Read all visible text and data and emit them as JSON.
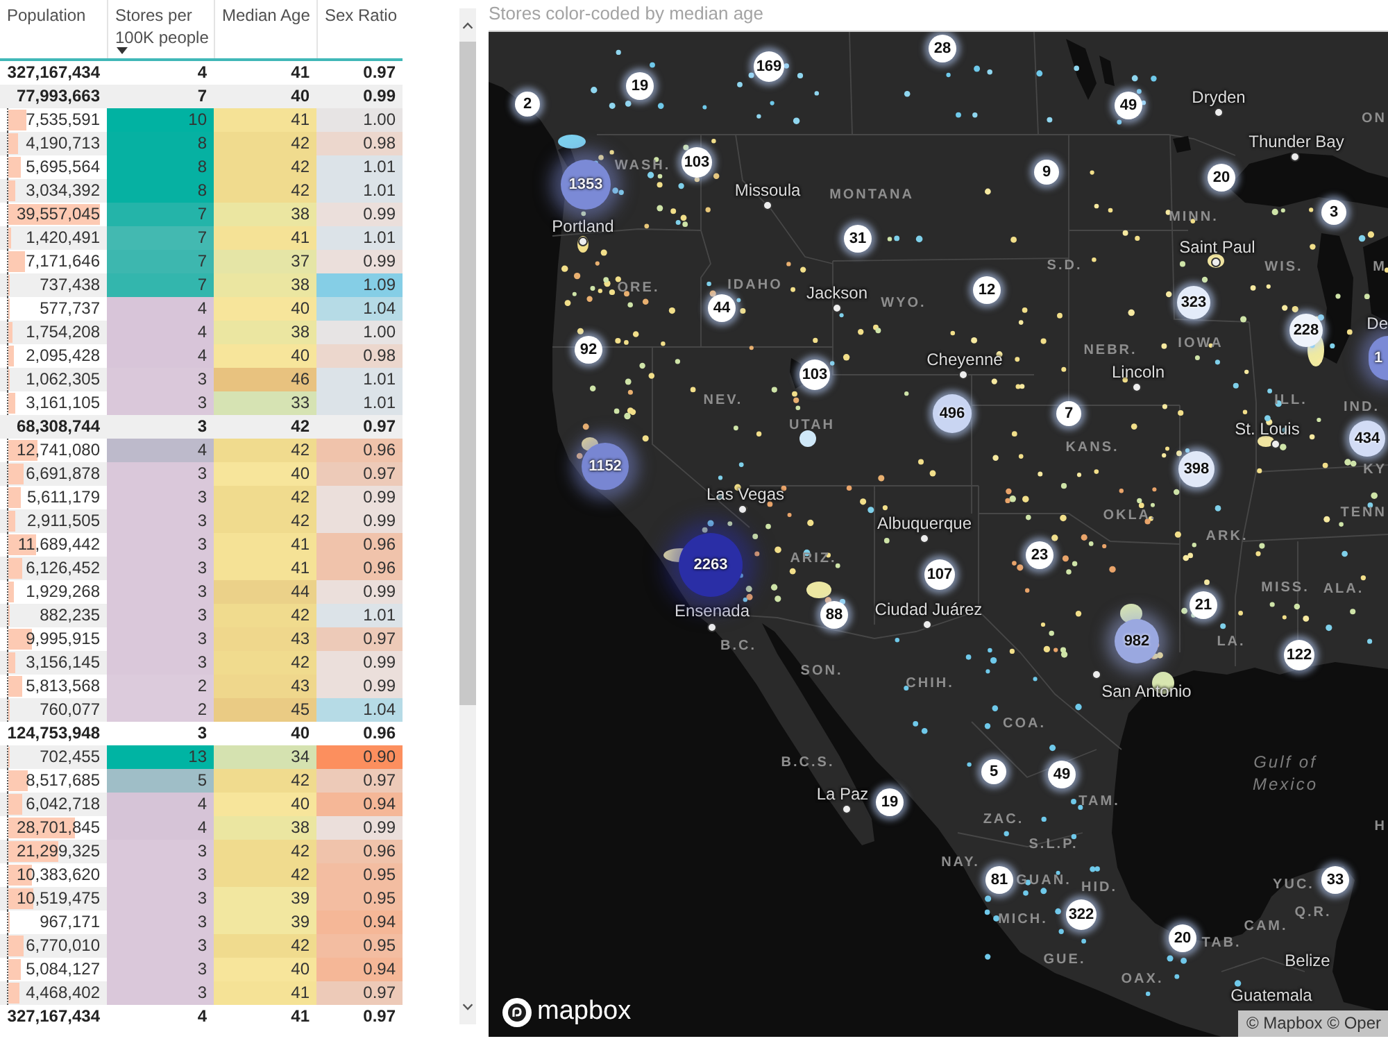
{
  "table": {
    "columns": [
      {
        "label": "Population",
        "sorted": false
      },
      {
        "label": "Stores per 100K people",
        "sorted": true
      },
      {
        "label": "Median Age",
        "sorted": false
      },
      {
        "label": "Sex Ratio",
        "sorted": false
      }
    ],
    "rows": [
      {
        "kind": "total",
        "cells": [
          {
            "text": "327,167,434"
          },
          {
            "text": "4"
          },
          {
            "text": "41"
          },
          {
            "text": "0.97"
          }
        ]
      },
      {
        "kind": "total",
        "cells": [
          {
            "text": "77,993,663"
          },
          {
            "text": "7"
          },
          {
            "text": "40"
          },
          {
            "text": "0.99"
          }
        ]
      },
      {
        "kind": "item",
        "cells": [
          {
            "text": "7,535,591",
            "level": 0.18
          },
          {
            "text": "10",
            "color": "#01b2a2"
          },
          {
            "text": "41",
            "color": "#f5e296"
          },
          {
            "text": "1.00",
            "color": "#e7e4e4"
          }
        ]
      },
      {
        "kind": "item",
        "cells": [
          {
            "text": "4,190,713",
            "level": 0.1
          },
          {
            "text": "8",
            "color": "#06b1a2"
          },
          {
            "text": "42",
            "color": "#f0db8e"
          },
          {
            "text": "0.98",
            "color": "#ecd7cd"
          }
        ]
      },
      {
        "kind": "item",
        "cells": [
          {
            "text": "5,695,564",
            "level": 0.13
          },
          {
            "text": "8",
            "color": "#06b1a2"
          },
          {
            "text": "42",
            "color": "#f0db8e"
          },
          {
            "text": "1.01",
            "color": "#dce3e8"
          }
        ]
      },
      {
        "kind": "item",
        "cells": [
          {
            "text": "3,034,392",
            "level": 0.07
          },
          {
            "text": "8",
            "color": "#06b1a2"
          },
          {
            "text": "42",
            "color": "#f0db8e"
          },
          {
            "text": "1.01",
            "color": "#dce3e8"
          }
        ]
      },
      {
        "kind": "item",
        "cells": [
          {
            "text": "39,557,045",
            "level": 0.93
          },
          {
            "text": "7",
            "color": "#24b4a9"
          },
          {
            "text": "38",
            "color": "#ebe6a1"
          },
          {
            "text": "0.99",
            "color": "#ebdfdb"
          }
        ]
      },
      {
        "kind": "item",
        "cells": [
          {
            "text": "1,420,491",
            "level": 0.03
          },
          {
            "text": "7",
            "color": "#43b9b1"
          },
          {
            "text": "41",
            "color": "#f5e296"
          },
          {
            "text": "1.01",
            "color": "#dce3e8"
          }
        ]
      },
      {
        "kind": "item",
        "cells": [
          {
            "text": "7,171,646",
            "level": 0.17
          },
          {
            "text": "7",
            "color": "#3db7af"
          },
          {
            "text": "37",
            "color": "#e5e5a6"
          },
          {
            "text": "0.99",
            "color": "#ebdfdb"
          }
        ]
      },
      {
        "kind": "item",
        "cells": [
          {
            "text": "737,438",
            "level": 0.02
          },
          {
            "text": "7",
            "color": "#33b6ad"
          },
          {
            "text": "38",
            "color": "#ebe6a1"
          },
          {
            "text": "1.09",
            "color": "#85cee6"
          }
        ]
      },
      {
        "kind": "item",
        "cells": [
          {
            "text": "577,737",
            "level": 0.01
          },
          {
            "text": "4",
            "color": "#d8c5d9"
          },
          {
            "text": "40",
            "color": "#f7e59b"
          },
          {
            "text": "1.04",
            "color": "#b6dbe6"
          }
        ]
      },
      {
        "kind": "item",
        "cells": [
          {
            "text": "1,754,208",
            "level": 0.04
          },
          {
            "text": "4",
            "color": "#d8c5d9"
          },
          {
            "text": "38",
            "color": "#ebe6a1"
          },
          {
            "text": "1.00",
            "color": "#e7e4e4"
          }
        ]
      },
      {
        "kind": "item",
        "cells": [
          {
            "text": "2,095,428",
            "level": 0.05
          },
          {
            "text": "4",
            "color": "#d8c5d9"
          },
          {
            "text": "40",
            "color": "#f7e59b"
          },
          {
            "text": "0.98",
            "color": "#ecd7cd"
          }
        ]
      },
      {
        "kind": "item",
        "cells": [
          {
            "text": "1,062,305",
            "level": 0.02
          },
          {
            "text": "3",
            "color": "#dac8da"
          },
          {
            "text": "46",
            "color": "#e8c27f"
          },
          {
            "text": "1.01",
            "color": "#dce3e8"
          }
        ]
      },
      {
        "kind": "item",
        "cells": [
          {
            "text": "3,161,105",
            "level": 0.07
          },
          {
            "text": "3",
            "color": "#dac8da"
          },
          {
            "text": "33",
            "color": "#d6e3b3"
          },
          {
            "text": "1.01",
            "color": "#dce3e8"
          }
        ]
      },
      {
        "kind": "total",
        "cells": [
          {
            "text": "68,308,744"
          },
          {
            "text": "3"
          },
          {
            "text": "42"
          },
          {
            "text": "0.97"
          }
        ]
      },
      {
        "kind": "item",
        "cells": [
          {
            "text": "12,741,080",
            "level": 0.3
          },
          {
            "text": "4",
            "color": "#bdbacb"
          },
          {
            "text": "42",
            "color": "#f0db8e"
          },
          {
            "text": "0.96",
            "color": "#f0c3ab"
          }
        ]
      },
      {
        "kind": "item",
        "cells": [
          {
            "text": "6,691,878",
            "level": 0.16
          },
          {
            "text": "3",
            "color": "#dac8da"
          },
          {
            "text": "40",
            "color": "#f7e59b"
          },
          {
            "text": "0.97",
            "color": "#edcab8"
          }
        ]
      },
      {
        "kind": "item",
        "cells": [
          {
            "text": "5,611,179",
            "level": 0.13
          },
          {
            "text": "3",
            "color": "#dac8da"
          },
          {
            "text": "42",
            "color": "#f0db8e"
          },
          {
            "text": "0.99",
            "color": "#ebdfdb"
          }
        ]
      },
      {
        "kind": "item",
        "cells": [
          {
            "text": "2,911,505",
            "level": 0.07
          },
          {
            "text": "3",
            "color": "#dac8da"
          },
          {
            "text": "42",
            "color": "#f0db8e"
          },
          {
            "text": "0.99",
            "color": "#ebdfdb"
          }
        ]
      },
      {
        "kind": "item",
        "cells": [
          {
            "text": "11,689,442",
            "level": 0.28
          },
          {
            "text": "3",
            "color": "#dac8da"
          },
          {
            "text": "41",
            "color": "#f5e296"
          },
          {
            "text": "0.96",
            "color": "#f0c3ab"
          }
        ]
      },
      {
        "kind": "item",
        "cells": [
          {
            "text": "6,126,452",
            "level": 0.14
          },
          {
            "text": "3",
            "color": "#dac8da"
          },
          {
            "text": "41",
            "color": "#f5e296"
          },
          {
            "text": "0.96",
            "color": "#f0c3ab"
          }
        ]
      },
      {
        "kind": "item",
        "cells": [
          {
            "text": "1,929,268",
            "level": 0.05
          },
          {
            "text": "3",
            "color": "#dac8da"
          },
          {
            "text": "44",
            "color": "#ebd189"
          },
          {
            "text": "0.99",
            "color": "#ebdfdb"
          }
        ]
      },
      {
        "kind": "item",
        "cells": [
          {
            "text": "882,235",
            "level": 0.02
          },
          {
            "text": "3",
            "color": "#dac8da"
          },
          {
            "text": "42",
            "color": "#f0db8e"
          },
          {
            "text": "1.01",
            "color": "#dce3e8"
          }
        ]
      },
      {
        "kind": "item",
        "cells": [
          {
            "text": "9,995,915",
            "level": 0.24
          },
          {
            "text": "3",
            "color": "#dac8da"
          },
          {
            "text": "43",
            "color": "#efd78c"
          },
          {
            "text": "0.97",
            "color": "#edcab8"
          }
        ]
      },
      {
        "kind": "item",
        "cells": [
          {
            "text": "3,156,145",
            "level": 0.07
          },
          {
            "text": "3",
            "color": "#dac8da"
          },
          {
            "text": "42",
            "color": "#f0db8e"
          },
          {
            "text": "0.99",
            "color": "#ebdfdb"
          }
        ]
      },
      {
        "kind": "item",
        "cells": [
          {
            "text": "5,813,568",
            "level": 0.14
          },
          {
            "text": "2",
            "color": "#dccbdc"
          },
          {
            "text": "43",
            "color": "#efd78c"
          },
          {
            "text": "0.99",
            "color": "#ebdfdb"
          }
        ]
      },
      {
        "kind": "item",
        "cells": [
          {
            "text": "760,077",
            "level": 0.02
          },
          {
            "text": "2",
            "color": "#dccbdc"
          },
          {
            "text": "45",
            "color": "#eacb84"
          },
          {
            "text": "1.04",
            "color": "#b6dbe6"
          }
        ]
      },
      {
        "kind": "total",
        "cells": [
          {
            "text": "124,753,948"
          },
          {
            "text": "3"
          },
          {
            "text": "40"
          },
          {
            "text": "0.96"
          }
        ]
      },
      {
        "kind": "item",
        "cells": [
          {
            "text": "702,455",
            "level": 0.02
          },
          {
            "text": "13",
            "color": "#00b4a3"
          },
          {
            "text": "34",
            "color": "#d5e2b0"
          },
          {
            "text": "0.90",
            "color": "#fc8f5e"
          }
        ]
      },
      {
        "kind": "item",
        "cells": [
          {
            "text": "8,517,685",
            "level": 0.2
          },
          {
            "text": "5",
            "color": "#9fbec7"
          },
          {
            "text": "42",
            "color": "#f0db8e"
          },
          {
            "text": "0.97",
            "color": "#edcab8"
          }
        ]
      },
      {
        "kind": "item",
        "cells": [
          {
            "text": "6,042,718",
            "level": 0.14
          },
          {
            "text": "4",
            "color": "#d6c4d7"
          },
          {
            "text": "40",
            "color": "#f7e59b"
          },
          {
            "text": "0.94",
            "color": "#f5b797"
          }
        ]
      },
      {
        "kind": "item",
        "cells": [
          {
            "text": "28,701,845",
            "level": 0.68
          },
          {
            "text": "4",
            "color": "#d6c4d7"
          },
          {
            "text": "38",
            "color": "#ebe6a1"
          },
          {
            "text": "0.99",
            "color": "#ebdfdb"
          }
        ]
      },
      {
        "kind": "item",
        "cells": [
          {
            "text": "21,299,325",
            "level": 0.5
          },
          {
            "text": "3",
            "color": "#dac8da"
          },
          {
            "text": "42",
            "color": "#f0db8e"
          },
          {
            "text": "0.96",
            "color": "#f0c3ab"
          }
        ]
      },
      {
        "kind": "item",
        "cells": [
          {
            "text": "10,383,620",
            "level": 0.24
          },
          {
            "text": "3",
            "color": "#dac8da"
          },
          {
            "text": "42",
            "color": "#f0db8e"
          },
          {
            "text": "0.95",
            "color": "#f3bda1"
          }
        ]
      },
      {
        "kind": "item",
        "cells": [
          {
            "text": "10,519,475",
            "level": 0.25
          },
          {
            "text": "3",
            "color": "#dac8da"
          },
          {
            "text": "39",
            "color": "#f2e7a0"
          },
          {
            "text": "0.95",
            "color": "#f3bda1"
          }
        ]
      },
      {
        "kind": "item",
        "cells": [
          {
            "text": "967,171",
            "level": 0.02
          },
          {
            "text": "3",
            "color": "#dac8da"
          },
          {
            "text": "39",
            "color": "#f2e7a0"
          },
          {
            "text": "0.94",
            "color": "#f5b797"
          }
        ]
      },
      {
        "kind": "item",
        "cells": [
          {
            "text": "6,770,010",
            "level": 0.16
          },
          {
            "text": "3",
            "color": "#dac8da"
          },
          {
            "text": "42",
            "color": "#f0db8e"
          },
          {
            "text": "0.95",
            "color": "#f3bda1"
          }
        ]
      },
      {
        "kind": "item",
        "cells": [
          {
            "text": "5,084,127",
            "level": 0.12
          },
          {
            "text": "3",
            "color": "#dac8da"
          },
          {
            "text": "40",
            "color": "#f7e59b"
          },
          {
            "text": "0.94",
            "color": "#f5b797"
          }
        ]
      },
      {
        "kind": "item",
        "cells": [
          {
            "text": "4,468,402",
            "level": 0.11
          },
          {
            "text": "3",
            "color": "#dac8da"
          },
          {
            "text": "41",
            "color": "#f5e296"
          },
          {
            "text": "0.97",
            "color": "#edcab8"
          }
        ]
      }
    ],
    "footer": {
      "cells": [
        {
          "text": "327,167,434"
        },
        {
          "text": "4"
        },
        {
          "text": "41"
        },
        {
          "text": "0.97"
        }
      ]
    }
  },
  "map": {
    "title": "Stores color-coded by median age",
    "places": [
      {
        "text": "Dryden",
        "kind": "city"
      },
      {
        "text": "ON",
        "kind": "region"
      },
      {
        "text": "Thunder Bay",
        "kind": "city"
      },
      {
        "text": "WASH.",
        "kind": "region"
      },
      {
        "text": "Missoula",
        "kind": "city"
      },
      {
        "text": "MONTANA",
        "kind": "region"
      },
      {
        "text": "Portland",
        "kind": "city"
      },
      {
        "text": "MINN.",
        "kind": "region"
      },
      {
        "text": "Saint Paul",
        "kind": "city"
      },
      {
        "text": "S.D.",
        "kind": "region"
      },
      {
        "text": "WIS.",
        "kind": "region"
      },
      {
        "text": "M",
        "kind": "region"
      },
      {
        "text": "ORE.",
        "kind": "region"
      },
      {
        "text": "IDAHO",
        "kind": "region"
      },
      {
        "text": "Jackson",
        "kind": "city"
      },
      {
        "text": "WYO.",
        "kind": "region"
      },
      {
        "text": "De",
        "kind": "city"
      },
      {
        "text": "Cheyenne",
        "kind": "city"
      },
      {
        "text": "NEBR.",
        "kind": "region"
      },
      {
        "text": "IOWA",
        "kind": "region"
      },
      {
        "text": "Lincoln",
        "kind": "city"
      },
      {
        "text": "NEV.",
        "kind": "region"
      },
      {
        "text": "ILL.",
        "kind": "region"
      },
      {
        "text": "IND.",
        "kind": "region"
      },
      {
        "text": "UTAH",
        "kind": "region"
      },
      {
        "text": "St. Louis",
        "kind": "city"
      },
      {
        "text": "KANS.",
        "kind": "region"
      },
      {
        "text": "KY",
        "kind": "region"
      },
      {
        "text": "Las Vegas",
        "kind": "city"
      },
      {
        "text": "Albuquerque",
        "kind": "city"
      },
      {
        "text": "OKLA.",
        "kind": "region"
      },
      {
        "text": "TENN",
        "kind": "region"
      },
      {
        "text": "ARK.",
        "kind": "region"
      },
      {
        "text": "ARIZ.",
        "kind": "region"
      },
      {
        "text": "MISS.",
        "kind": "region"
      },
      {
        "text": "ALA.",
        "kind": "region"
      },
      {
        "text": "Ensenada",
        "kind": "city"
      },
      {
        "text": "Ciudad Juárez",
        "kind": "city"
      },
      {
        "text": "B.C.",
        "kind": "region"
      },
      {
        "text": "LA.",
        "kind": "region"
      },
      {
        "text": "SON.",
        "kind": "region"
      },
      {
        "text": "CHIH.",
        "kind": "region"
      },
      {
        "text": "San Antonio",
        "kind": "city"
      },
      {
        "text": "COA.",
        "kind": "region"
      },
      {
        "text": "B.C.S.",
        "kind": "region"
      },
      {
        "text": "La Paz",
        "kind": "city"
      },
      {
        "text": "TAM.",
        "kind": "region"
      },
      {
        "text": "Gulf of Mexico",
        "kind": "water"
      },
      {
        "text": "ZAC.",
        "kind": "region"
      },
      {
        "text": "H",
        "kind": "region"
      },
      {
        "text": "S.L.P.",
        "kind": "region"
      },
      {
        "text": "NAY.",
        "kind": "region"
      },
      {
        "text": "GUAN.",
        "kind": "region"
      },
      {
        "text": "HID.",
        "kind": "region"
      },
      {
        "text": "YUC.",
        "kind": "region"
      },
      {
        "text": "MICH.",
        "kind": "region"
      },
      {
        "text": "CAM.",
        "kind": "region"
      },
      {
        "text": "Q.R.",
        "kind": "region"
      },
      {
        "text": "TAB.",
        "kind": "region"
      },
      {
        "text": "GUE.",
        "kind": "region"
      },
      {
        "text": "Belize",
        "kind": "country"
      },
      {
        "text": "OAX.",
        "kind": "region"
      },
      {
        "text": "Guatemala",
        "kind": "country"
      }
    ],
    "clusters": [
      {
        "label": "28",
        "color": "#ffffff"
      },
      {
        "label": "169",
        "color": "#ffffff"
      },
      {
        "label": "19",
        "color": "#ffffff"
      },
      {
        "label": "2",
        "color": "#ffffff"
      },
      {
        "label": "49",
        "color": "#ffffff"
      },
      {
        "label": "1353",
        "color": "#7b8ad6"
      },
      {
        "label": "103",
        "color": "#ffffff"
      },
      {
        "label": "9",
        "color": "#ffffff"
      },
      {
        "label": "20",
        "color": "#ffffff"
      },
      {
        "label": "3",
        "color": "#ffffff"
      },
      {
        "label": "31",
        "color": "#ffffff"
      },
      {
        "label": "12",
        "color": "#ffffff"
      },
      {
        "label": "44",
        "color": "#ffffff"
      },
      {
        "label": "323",
        "color": "#e4ecfa"
      },
      {
        "label": "228",
        "color": "#eef3fb"
      },
      {
        "label": "92",
        "color": "#ffffff"
      },
      {
        "label": "103",
        "color": "#ffffff"
      },
      {
        "label": "1",
        "color": "#7b8ad6"
      },
      {
        "label": "496",
        "color": "#c9d5f2"
      },
      {
        "label": "7",
        "color": "#ffffff"
      },
      {
        "label": "434",
        "color": "#d2dcf5"
      },
      {
        "label": "1152",
        "color": "#7886d2"
      },
      {
        "label": "398",
        "color": "#e0e8f8"
      },
      {
        "label": "2263",
        "color": "#2a2ea6"
      },
      {
        "label": "23",
        "color": "#ffffff"
      },
      {
        "label": "107",
        "color": "#ffffff"
      },
      {
        "label": "88",
        "color": "#ffffff"
      },
      {
        "label": "21",
        "color": "#ffffff"
      },
      {
        "label": "982",
        "color": "#9aa8e0"
      },
      {
        "label": "122",
        "color": "#ffffff"
      },
      {
        "label": "5",
        "color": "#ffffff"
      },
      {
        "label": "49",
        "color": "#ffffff"
      },
      {
        "label": "19",
        "color": "#ffffff"
      },
      {
        "label": "81",
        "color": "#ffffff"
      },
      {
        "label": "33",
        "color": "#ffffff"
      },
      {
        "label": "322",
        "color": "#ffffff"
      },
      {
        "label": "20",
        "color": "#ffffff"
      }
    ],
    "logo": "mapbox",
    "attribution": "© Mapbox © Oper"
  }
}
